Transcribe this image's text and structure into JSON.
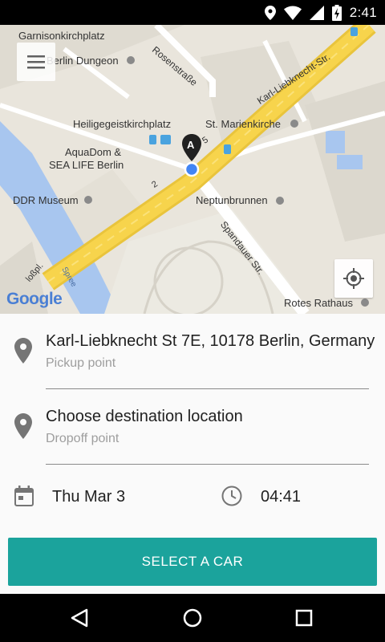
{
  "status_bar": {
    "time": "2:41"
  },
  "map": {
    "labels": {
      "garnisonkirchplatz": "Garnisonkirchplatz",
      "berlin_dungeon": "Berlin Dungeon",
      "rosenstrasse": "Rosenstraße",
      "karl_liebknecht_str": "Karl-Liebknecht-Str.",
      "heiligegeistkirchplatz": "Heiligegeistkirchplatz",
      "st_marienkirche": "St. Marienkirche",
      "aquadom_line1": "AquaDom &",
      "aquadom_line2": "SEA LIFE Berlin",
      "ddr_museum": "DDR Museum",
      "neptunbrunnen": "Neptunbrunnen",
      "spandauer_str": "Spandauer Str.",
      "rotes_rathaus": "Rotes Rathaus",
      "road_number_2": "2",
      "road_number_5": "5",
      "spree": "Spree",
      "schlossplatz": "loßpl.",
      "marker_letter": "A",
      "google": "Google"
    }
  },
  "pickup": {
    "address": "Karl-Liebknecht St 7E, 10178 Berlin, Germany",
    "label": "Pickup point"
  },
  "dropoff": {
    "address": "Choose destination location",
    "label": "Dropoff point"
  },
  "schedule": {
    "date": "Thu Mar 3",
    "time": "04:41"
  },
  "actions": {
    "select_car": "SELECT A CAR"
  },
  "colors": {
    "accent": "#1ba39c",
    "road_major": "#f7d44c",
    "water": "#a8c6ef",
    "marker_blue": "#4285f4"
  }
}
